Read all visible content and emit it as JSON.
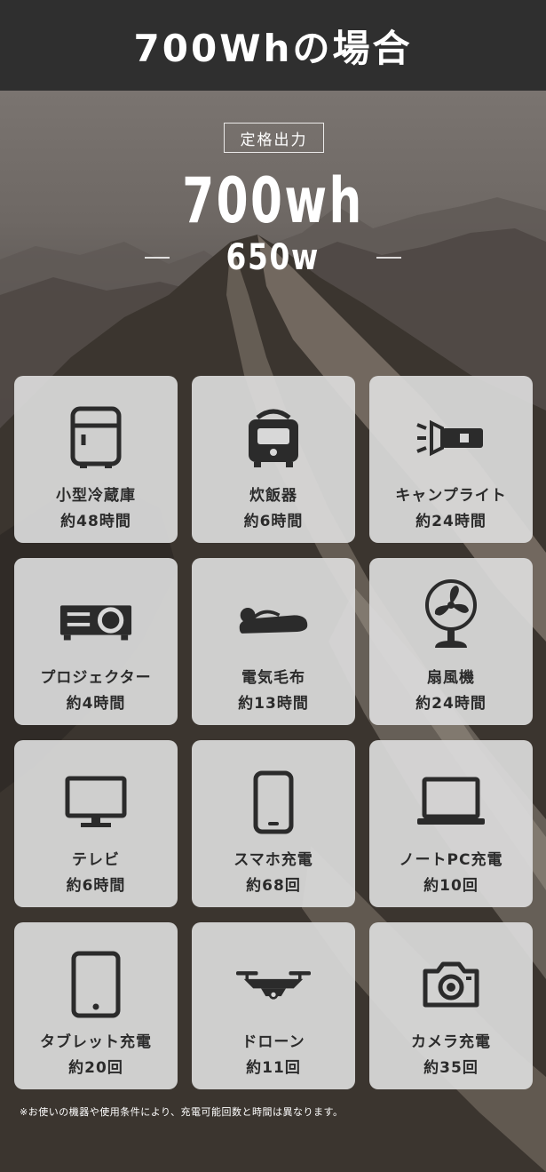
{
  "header": {
    "title": "700Whの場合"
  },
  "spec": {
    "badge": "定格出力",
    "capacity": "700wh",
    "output": "650w"
  },
  "cards": [
    {
      "name": "小型冷蔵庫",
      "time": "約48時間",
      "icon": "fridge-icon"
    },
    {
      "name": "炊飯器",
      "time": "約6時間",
      "icon": "rice-cooker-icon"
    },
    {
      "name": "キャンプライト",
      "time": "約24時間",
      "icon": "flashlight-icon"
    },
    {
      "name": "プロジェクター",
      "time": "約4時間",
      "icon": "projector-icon"
    },
    {
      "name": "電気毛布",
      "time": "約13時間",
      "icon": "electric-blanket-icon"
    },
    {
      "name": "扇風機",
      "time": "約24時間",
      "icon": "fan-icon"
    },
    {
      "name": "テレビ",
      "time": "約6時間",
      "icon": "tv-icon"
    },
    {
      "name": "スマホ充電",
      "time": "約68回",
      "icon": "smartphone-icon"
    },
    {
      "name": "ノートPC充電",
      "time": "約10回",
      "icon": "laptop-icon"
    },
    {
      "name": "タブレット充電",
      "time": "約20回",
      "icon": "tablet-icon"
    },
    {
      "name": "ドローン",
      "time": "約11回",
      "icon": "drone-icon"
    },
    {
      "name": "カメラ充電",
      "time": "約35回",
      "icon": "camera-icon"
    }
  ],
  "note": "※お使いの機器や使用条件により、充電可能回数と時間は異なります。"
}
